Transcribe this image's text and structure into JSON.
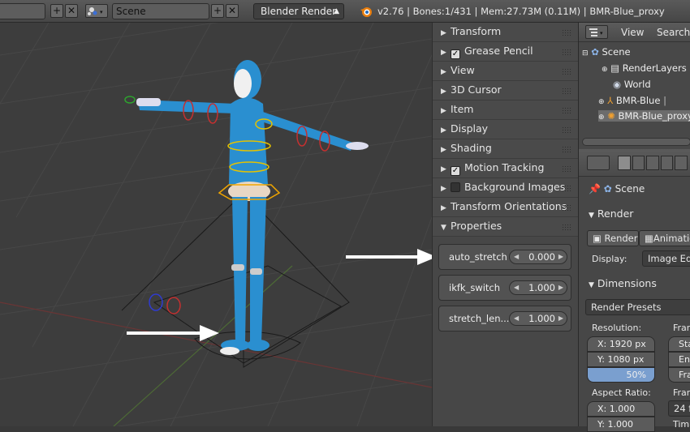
{
  "topbar": {
    "layout_field_value": "",
    "scene_field_value": "Scene",
    "render_engine": "Blender Render",
    "status_text": "v2.76 | Bones:1/431  | Mem:27.73M (0.11M) | BMR-Blue_proxy"
  },
  "npanel": {
    "sections": [
      {
        "label": "Transform",
        "checkbox": null,
        "expanded": false
      },
      {
        "label": "Grease Pencil",
        "checkbox": true,
        "expanded": false
      },
      {
        "label": "View",
        "checkbox": null,
        "expanded": false
      },
      {
        "label": "3D Cursor",
        "checkbox": null,
        "expanded": false
      },
      {
        "label": "Item",
        "checkbox": null,
        "expanded": false
      },
      {
        "label": "Display",
        "checkbox": null,
        "expanded": false
      },
      {
        "label": "Shading",
        "checkbox": null,
        "expanded": false
      },
      {
        "label": "Motion Tracking",
        "checkbox": true,
        "expanded": false
      },
      {
        "label": "Background Images",
        "checkbox": false,
        "expanded": false
      },
      {
        "label": "Transform Orientations",
        "checkbox": null,
        "expanded": false
      },
      {
        "label": "Properties",
        "checkbox": null,
        "expanded": true
      }
    ],
    "properties": [
      {
        "label": "auto_stretch",
        "value": "0.000"
      },
      {
        "label": "ikfk_switch",
        "value": "1.000"
      },
      {
        "label": "stretch_len...",
        "value": "1.000"
      }
    ]
  },
  "outliner": {
    "view_menu": "View",
    "search_menu": "Search",
    "items": [
      {
        "label": "Scene",
        "icon": "scene-icon"
      },
      {
        "label": "RenderLayers",
        "icon": "renderlayers-icon"
      },
      {
        "label": "World",
        "icon": "world-icon"
      },
      {
        "label": "BMR-Blue",
        "icon": "armature-icon"
      },
      {
        "label": "BMR-Blue_proxy",
        "icon": "armature-proxy-icon"
      }
    ]
  },
  "properties_editor": {
    "context_label": "Scene",
    "render_section": "Render",
    "render_button": "Render",
    "animation_button": "Animatio",
    "display_label": "Display:",
    "display_value": "Image Edit",
    "dimensions_section": "Dimensions",
    "render_presets": "Render Presets",
    "resolution_label": "Resolution:",
    "res_x": "X:  1920 px",
    "res_y": "Y:  1080 px",
    "res_percent": "50%",
    "aspect_label": "Aspect Ratio:",
    "aspect_x": "X:        1.000",
    "aspect_y": "Y:        1.000",
    "frame_label_1": "Fran",
    "frame_sta": "Sta",
    "frame_end": "End",
    "frame_fra": "Fra",
    "frame_label_2": "Fran",
    "fps_value": "24 f",
    "time_label": "Tim"
  },
  "colors": {
    "body_blue": "#2a8fd0",
    "arrow": "#ffffff",
    "header_bg": "#4f4f4f"
  }
}
